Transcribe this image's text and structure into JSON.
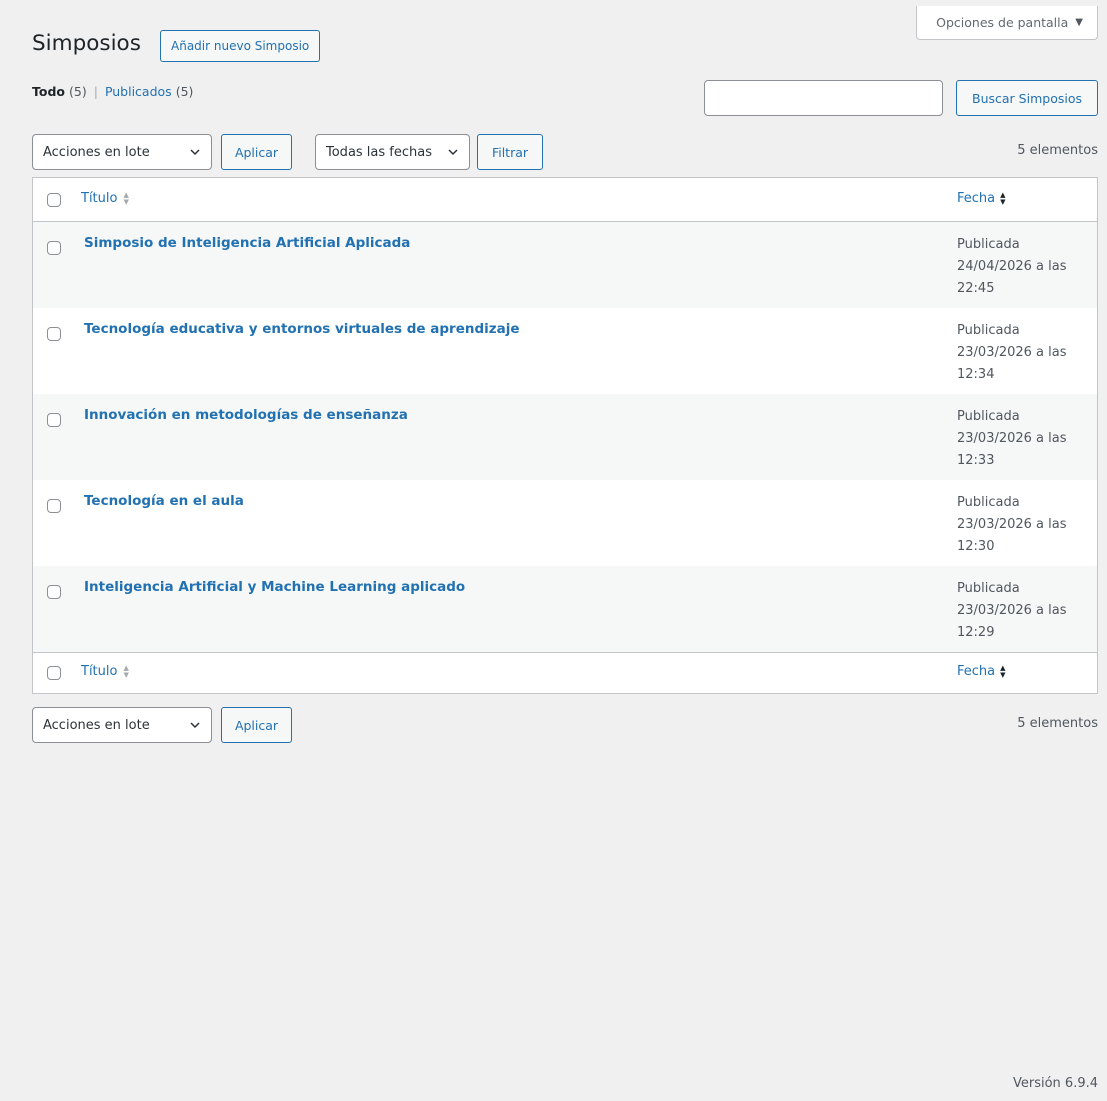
{
  "screen_options": {
    "label": "Opciones de pantalla",
    "caret": "▼"
  },
  "header": {
    "title": "Simposios",
    "add_new": "Añadir nuevo Simposio"
  },
  "views": {
    "all": {
      "label": "Todo",
      "count": "(5)"
    },
    "separator": "|",
    "published": {
      "label": "Publicados",
      "count": "(5)"
    }
  },
  "search": {
    "value": "",
    "placeholder": "",
    "button": "Buscar Simposios"
  },
  "tablenav_top": {
    "bulk_select": "Acciones en lote",
    "apply": "Aplicar",
    "dates_select": "Todas las fechas",
    "filter": "Filtrar",
    "count": "5 elementos"
  },
  "table": {
    "columns": {
      "title": "Título",
      "date": "Fecha"
    },
    "rows": [
      {
        "title": "Simposio de Inteligencia Artificial Aplicada",
        "status": "Publicada",
        "date": "24/04/2026 a las",
        "time": "22:45"
      },
      {
        "title": "Tecnología educativa y entornos virtuales de aprendizaje",
        "status": "Publicada",
        "date": "23/03/2026 a las",
        "time": "12:34"
      },
      {
        "title": "Innovación en metodologías de enseñanza",
        "status": "Publicada",
        "date": "23/03/2026 a las",
        "time": "12:33"
      },
      {
        "title": "Tecnología en el aula",
        "status": "Publicada",
        "date": "23/03/2026 a las",
        "time": "12:30"
      },
      {
        "title": "Inteligencia Artificial y Machine Learning aplicado",
        "status": "Publicada",
        "date": "23/03/2026 a las",
        "time": "12:29"
      }
    ]
  },
  "tablenav_bottom": {
    "bulk_select": "Acciones en lote",
    "apply": "Aplicar",
    "count": "5 elementos"
  },
  "footer": {
    "version": "Versión 6.9.4"
  },
  "colors": {
    "link": "#2271b1",
    "background": "#f0f0f1",
    "text": "#3c434a"
  }
}
